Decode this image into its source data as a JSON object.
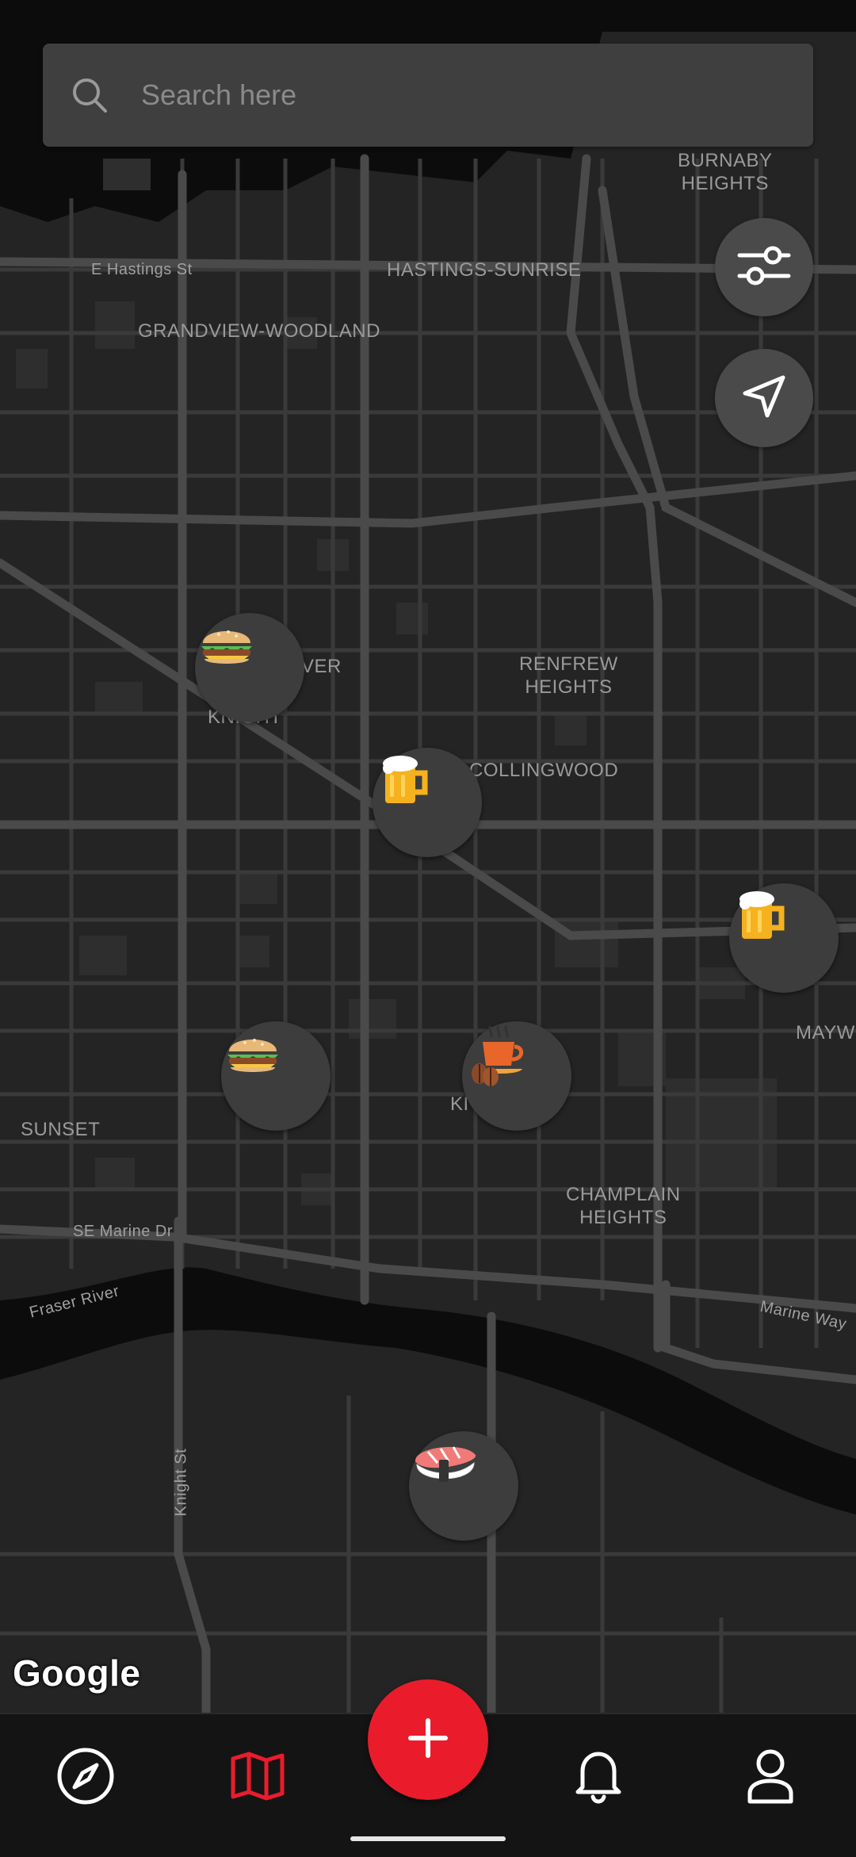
{
  "search": {
    "placeholder": "Search here"
  },
  "map": {
    "labels": {
      "burnaby_heights": "BURNABY\nHEIGHTS",
      "e_hastings": "E Hastings St",
      "hastings_sunrise": "HASTINGS-SUNRISE",
      "grandview": "GRANDVIEW-WOODLAND",
      "renfrew": "RENFREW\nHEIGHTS",
      "ver": "VER",
      "knight": "KNIGHT",
      "collingwood": "COLLINGWOOD",
      "maywood": "MAYWO",
      "sunset": "SUNSET",
      "ki": "KI",
      "champlain": "CHAMPLAIN\nHEIGHTS",
      "se_marine": "SE Marine Dr",
      "fraser_river": "Fraser River",
      "marine_way": "Marine Way",
      "knight_st": "Knight St"
    },
    "attribution": "Google",
    "markers": [
      {
        "name": "burger",
        "icon": "burger-icon"
      },
      {
        "name": "beer",
        "icon": "beer-icon"
      },
      {
        "name": "beer",
        "icon": "beer-icon"
      },
      {
        "name": "burger",
        "icon": "burger-icon"
      },
      {
        "name": "coffee",
        "icon": "coffee-icon"
      },
      {
        "name": "sushi",
        "icon": "sushi-icon"
      }
    ]
  },
  "controls": {
    "filter_icon": "sliders-icon",
    "location_icon": "navigation-arrow-icon"
  },
  "nav": {
    "items": [
      {
        "icon": "compass-icon",
        "active": false
      },
      {
        "icon": "map-icon",
        "active": true
      },
      {
        "icon": "bell-icon",
        "active": false
      },
      {
        "icon": "profile-icon",
        "active": false
      }
    ],
    "add_icon": "plus-icon",
    "accent": "#ea1c2c"
  }
}
